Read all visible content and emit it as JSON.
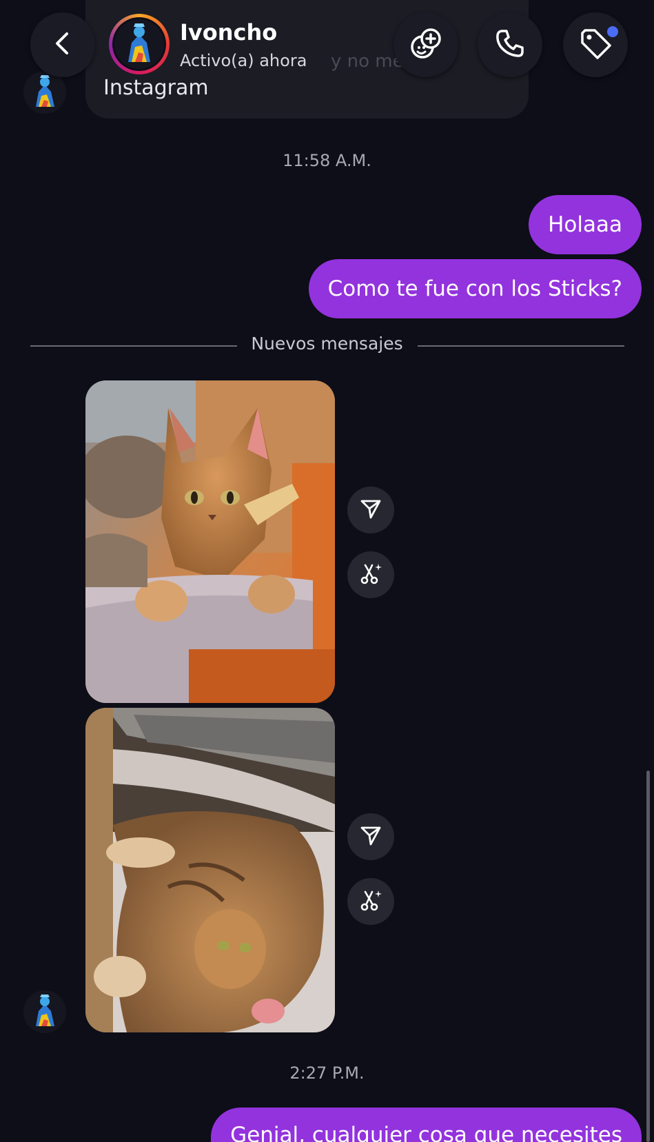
{
  "header": {
    "contact_name": "Ivoncho",
    "status": "Activo(a) ahora",
    "icons": {
      "back": "chevron-left-icon",
      "sticker": "sticker-add-icon",
      "call": "phone-icon",
      "tag": "tag-icon"
    },
    "tag_badge_color": "#4b6cf5"
  },
  "previous_message": {
    "visible_text": "Instagram",
    "faded_overlay_text": "y no me"
  },
  "messages": {
    "time_1": "11:58 A.M.",
    "sent_1": "Holaaa",
    "sent_2": "Como te fue con los Sticks?",
    "new_messages_divider": "Nuevos mensajes",
    "time_2": "2:27 P.M.",
    "sent_3": "Genial, cualquier cosa que necesites"
  },
  "photos": [
    {
      "subject": "cat sitting on scratching post",
      "actions": [
        "share-icon",
        "remix-icon"
      ]
    },
    {
      "subject": "cat lying upside down in sun",
      "actions": [
        "share-icon",
        "remix-icon"
      ]
    }
  ],
  "colors": {
    "background": "#0d0e18",
    "sent_bubble": "#9333dd",
    "header_button": "#1a1b24",
    "action_button": "#262730"
  }
}
